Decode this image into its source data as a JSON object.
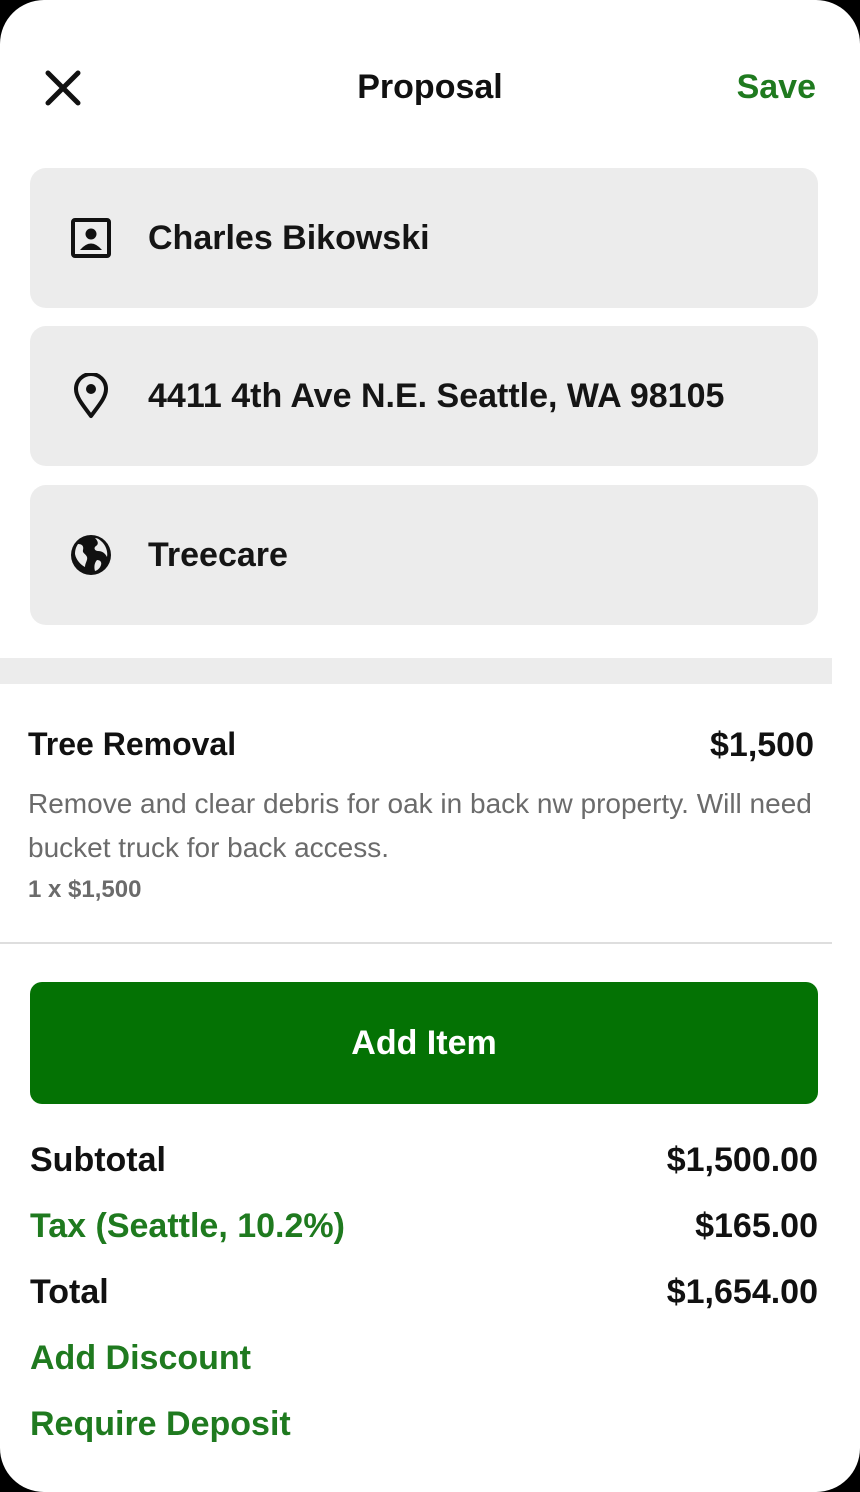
{
  "header": {
    "title": "Proposal",
    "save_label": "Save",
    "close_icon": "close-icon"
  },
  "fields": {
    "client": {
      "icon": "contact-card-icon",
      "value": "Charles Bikowski"
    },
    "address": {
      "icon": "location-pin-icon",
      "value": "4411 4th Ave N.E. Seattle, WA 98105"
    },
    "service": {
      "icon": "globe-icon",
      "value": "Treecare"
    }
  },
  "line_item": {
    "name": "Tree Removal",
    "price": "$1,500",
    "description": "Remove and clear debris for oak in back nw property. Will need bucket truck for back access.",
    "quantity_text": "1 x $1,500"
  },
  "add_item_label": "Add Item",
  "summary": {
    "subtotal_label": "Subtotal",
    "subtotal_value": "$1,500.00",
    "tax_label": "Tax (Seattle, 10.2%)",
    "tax_value": "$165.00",
    "total_label": "Total",
    "total_value": "$1,654.00"
  },
  "actions": {
    "add_discount": "Add Discount",
    "require_deposit": "Require Deposit"
  },
  "colors": {
    "accent_green": "#1f7a1f",
    "button_green": "#047204",
    "field_gray": "#ececec"
  }
}
